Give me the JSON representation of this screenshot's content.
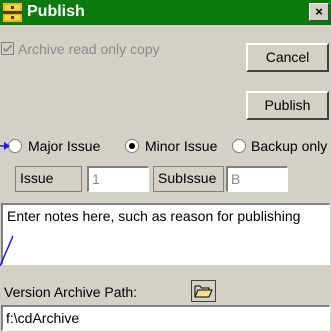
{
  "window": {
    "title": "Publish",
    "titlebar_color": "#0a7a0e",
    "title_icon": "publish-app-icon",
    "close_glyph": "×"
  },
  "archive_checkbox": {
    "label": "Archive read only copy",
    "checked": true,
    "enabled": false
  },
  "buttons": {
    "cancel": "Cancel",
    "publish": "Publish"
  },
  "issue_type": {
    "options": [
      "Major Issue",
      "Minor Issue",
      "Backup only"
    ],
    "selected": "Minor Issue"
  },
  "issue": {
    "label": "Issue",
    "value": "1"
  },
  "subissue": {
    "label": "SubIssue",
    "value": "B"
  },
  "notes": {
    "value": "Enter notes here, such as reason for publishing"
  },
  "version_archive": {
    "label": "Version Archive Path:",
    "browse_icon": "folder-open-icon",
    "path": "f:\\cdArchive"
  },
  "annotation_color": "#1a1ae6"
}
